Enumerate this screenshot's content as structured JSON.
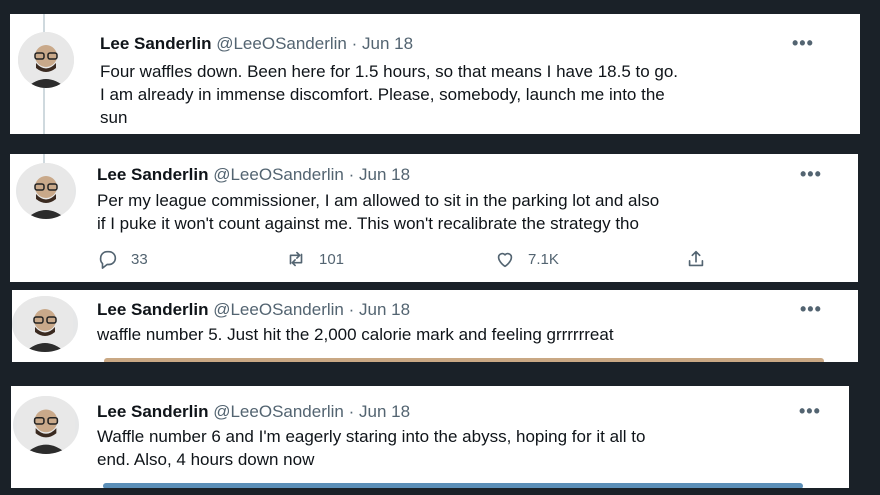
{
  "tweets": [
    {
      "author": {
        "name": "Lee Sanderlin",
        "handle": "@LeeOSanderlin"
      },
      "separator": "·",
      "date": "Jun 18",
      "more": "•••",
      "lines": [
        "Four waffles down. Been here for 1.5 hours, so that means I have 18.5 to go.",
        "I am already in immense discomfort. Please, somebody, launch me into the",
        "sun"
      ]
    },
    {
      "author": {
        "name": "Lee Sanderlin",
        "handle": "@LeeOSanderlin"
      },
      "separator": "·",
      "date": "Jun 18",
      "more": "•••",
      "lines": [
        "Per my league commissioner, I am allowed to sit in the parking lot and also",
        "if I puke it won't count against me. This won't recalibrate the strategy tho"
      ],
      "actions": {
        "replies": "33",
        "retweets": "101",
        "likes": "7.1K"
      }
    },
    {
      "author": {
        "name": "Lee Sanderlin",
        "handle": "@LeeOSanderlin"
      },
      "separator": "·",
      "date": "Jun 18",
      "more": "•••",
      "lines": [
        "waffle number 5. Just hit the 2,000 calorie mark and feeling grrrrrreat"
      ]
    },
    {
      "author": {
        "name": "Lee Sanderlin",
        "handle": "@LeeOSanderlin"
      },
      "separator": "·",
      "date": "Jun 18",
      "more": "•••",
      "lines": [
        "Waffle number 6 and I'm eagerly staring into the abyss, hoping for it all to",
        "end.  Also, 4 hours down now"
      ]
    }
  ],
  "icons": {
    "reply": "reply-icon",
    "retweet": "retweet-icon",
    "like": "heart-icon",
    "share": "share-icon",
    "more": "more-icon"
  },
  "colors": {
    "background": "#1a2128",
    "card": "#ffffff",
    "muted": "#536471",
    "text": "#0f1419",
    "thread": "#cfd9de"
  }
}
